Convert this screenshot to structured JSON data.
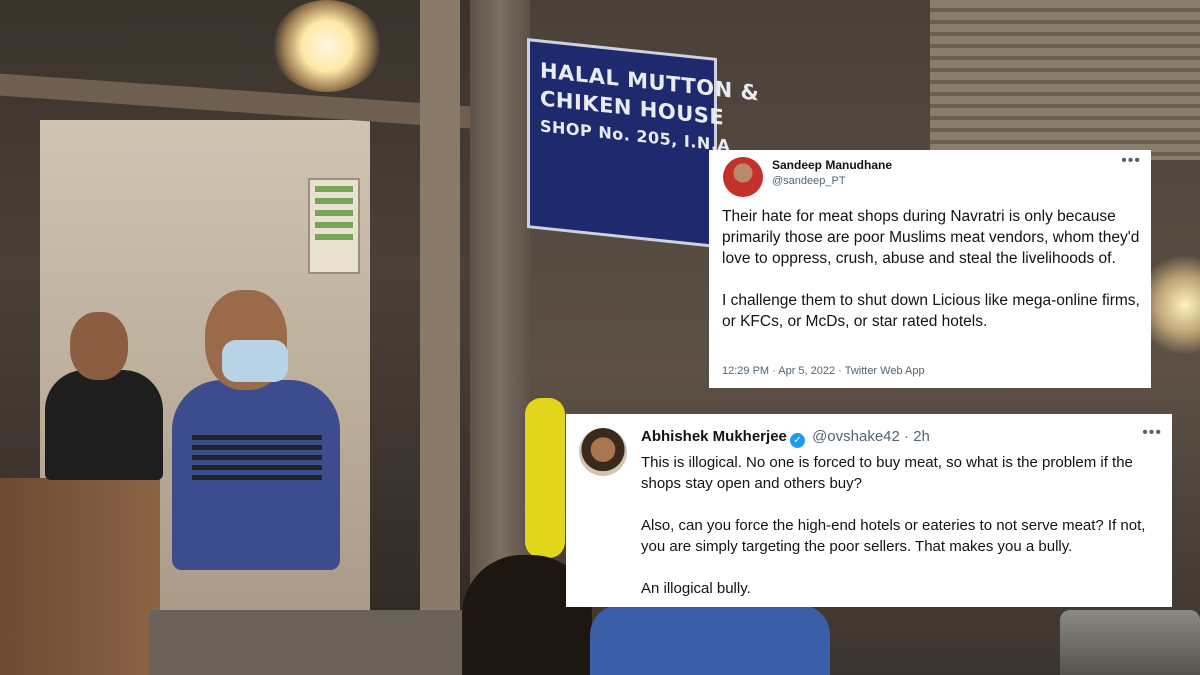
{
  "background": {
    "shop_sign": [
      "HALAL MUTTON &",
      "CHIKEN HOUSE",
      "SHOP No. 205, I.N.A"
    ]
  },
  "tweet_1": {
    "author_name": "Sandeep Manudhane",
    "handle": "@sandeep_PT",
    "paragraphs": [
      "Their hate for meat shops during Navratri is only because primarily those are poor Muslims meat vendors, whom they'd love to oppress, crush, abuse and steal the livelihoods of.",
      "I challenge them to shut down Licious like mega-online firms, or KFCs, or McDs, or star rated hotels."
    ],
    "meta": "12:29 PM · Apr 5, 2022 · Twitter Web App",
    "more_icon": "more-horizontal-icon"
  },
  "tweet_2": {
    "author_name": "Abhishek Mukherjee",
    "verified_icon": "verified-badge-icon",
    "handle": "@ovshake42",
    "separator": "·",
    "time": "2h",
    "paragraphs": [
      "This is illogical. No one is forced to buy meat, so what is the problem if the shops stay open and others buy?",
      "Also, can you force the high-end hotels or eateries to not serve meat? If not, you are simply targeting the poor sellers. That makes you a bully.",
      "An illogical bully."
    ],
    "more_icon": "more-horizontal-icon"
  },
  "colors": {
    "verified": "#1d9bf0",
    "text_primary": "#0f1419",
    "text_secondary": "#536471",
    "sign_blue": "#1f2a6e"
  }
}
